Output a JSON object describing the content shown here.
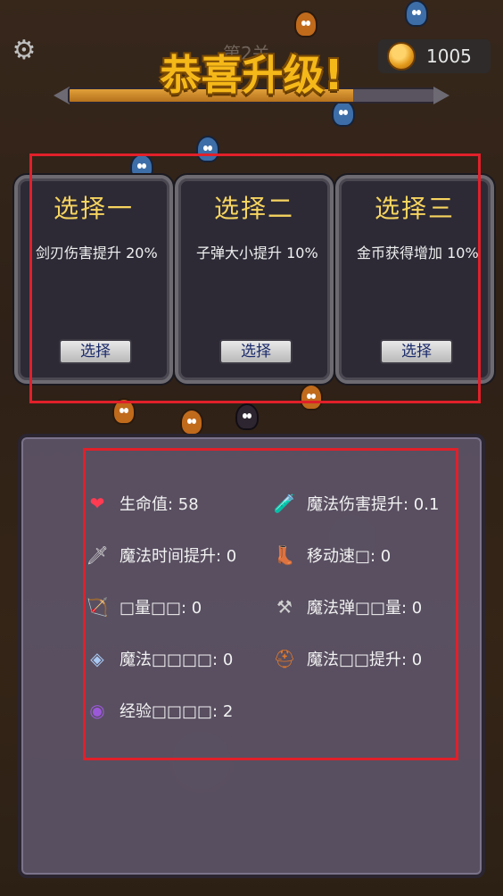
{
  "hud": {
    "settings_icon": "gear-icon",
    "level_label": "第2关",
    "coin_icon": "gold-coin-icon",
    "coin_count": "1005",
    "title": "恭喜升级!",
    "exp_progress": 0.78
  },
  "choices": [
    {
      "title": "选择一",
      "desc": "剑刃伤害提升 20%",
      "button": "选择"
    },
    {
      "title": "选择二",
      "desc": "子弹大小提升 10%",
      "button": "选择"
    },
    {
      "title": "选择三",
      "desc": "金币获得增加 10%",
      "button": "选择"
    }
  ],
  "stats": {
    "hp": {
      "icon": "heart-icon",
      "label": "生命值: 58"
    },
    "magic_damage": {
      "icon": "potion-icon",
      "label": "魔法伤害提升: 0.1"
    },
    "magic_time": {
      "icon": "sword-icon",
      "label": "魔法时间提升: 0"
    },
    "move_speed": {
      "icon": "boot-icon",
      "label": "移动速□: 0"
    },
    "bow": {
      "icon": "bow-icon",
      "label": "□量□□: 0"
    },
    "magic_bullet": {
      "icon": "axe-icon",
      "label": "魔法弹□□量: 0"
    },
    "magic_shield": {
      "icon": "stone-icon",
      "label": "魔法□□□□: 0"
    },
    "magic_boost": {
      "icon": "cauldron-icon",
      "label": "魔法□□提升: 0"
    },
    "exp": {
      "icon": "eye-orb-icon",
      "label": "经验□□□□: 2"
    }
  },
  "colors": {
    "highlight_frame": "#e0202a",
    "card_title": "#f6d45f",
    "title_gold": "#f5b819"
  }
}
